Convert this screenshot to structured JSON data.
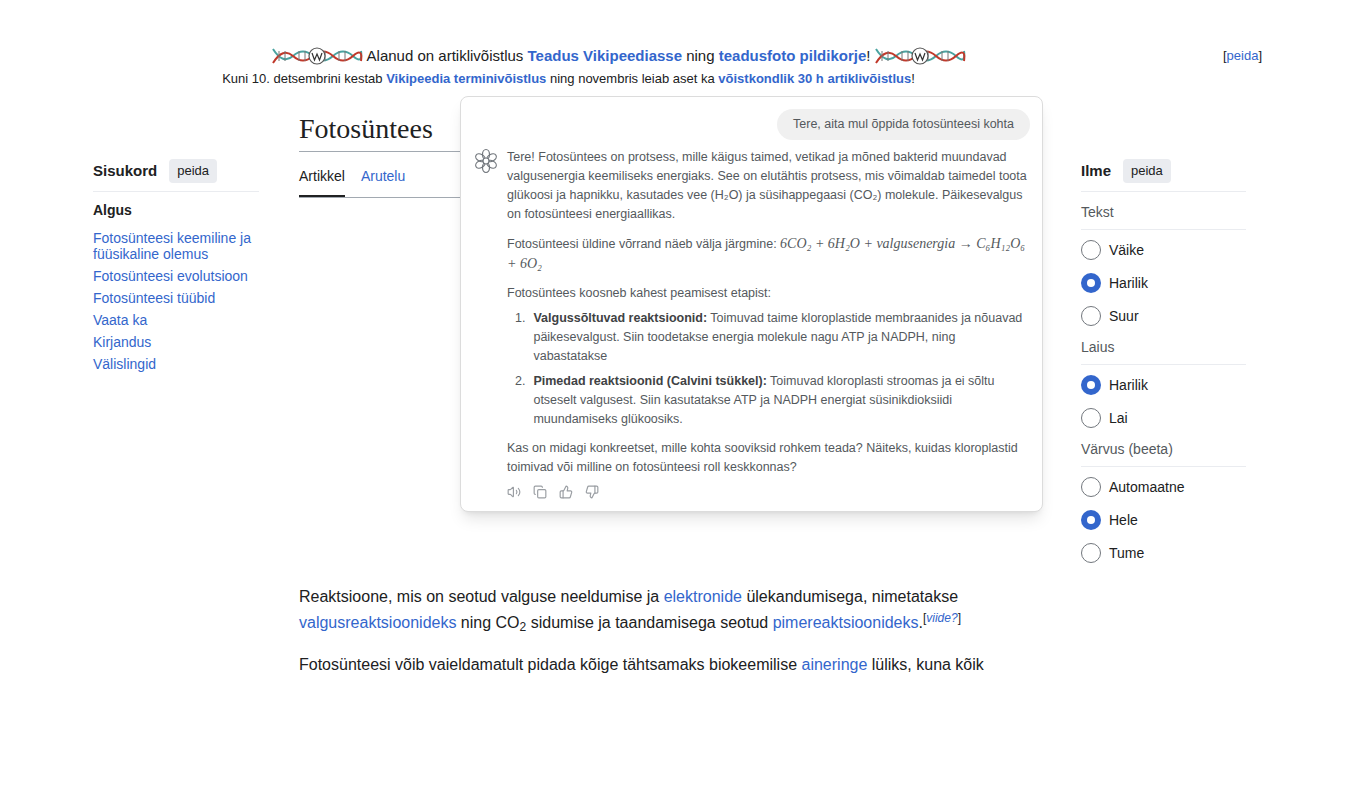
{
  "banner": {
    "line1": [
      {
        "kind": "text",
        "text": "Alanud on artiklivõistlus "
      },
      {
        "kind": "link",
        "text": "Teadus Vikipeediasse"
      },
      {
        "kind": "text",
        "text": " ning "
      },
      {
        "kind": "link",
        "text": "teadusfoto pildikorje"
      },
      {
        "kind": "text",
        "text": "!"
      }
    ],
    "line2": [
      {
        "kind": "text",
        "text": "Kuni 10. detsembrini kestab "
      },
      {
        "kind": "link",
        "text": "Vikipeedia terminivõistlus"
      },
      {
        "kind": "text",
        "text": " ning novembris leiab aset ka "
      },
      {
        "kind": "link",
        "text": "võistkondlik 30 h artiklivõistlus"
      },
      {
        "kind": "text",
        "text": "!"
      }
    ],
    "hide": {
      "open": "[",
      "text": "peida",
      "close": "]"
    }
  },
  "sidebar": {
    "title": "Sisukord",
    "hide": "peida",
    "items": [
      {
        "label": "Algus",
        "selected": true
      },
      {
        "label": "Fotosünteesi keemiline ja füüsikaline olemus",
        "selected": false
      },
      {
        "label": "Fotosünteesi evolutsioon",
        "selected": false
      },
      {
        "label": "Fotosünteesi tüübid",
        "selected": false
      },
      {
        "label": "Vaata ka",
        "selected": false
      },
      {
        "label": "Kirjandus",
        "selected": false
      },
      {
        "label": "Välislingid",
        "selected": false
      }
    ]
  },
  "article": {
    "title": "Fotosüntees",
    "tabs": [
      {
        "label": "Artikkel",
        "selected": true
      },
      {
        "label": "Arutelu",
        "selected": false
      }
    ],
    "paragraphs": [
      [
        {
          "kind": "text",
          "text": "Reaktsioone, mis on seotud valguse neeldumise ja "
        },
        {
          "kind": "link",
          "text": "elektronide"
        },
        {
          "kind": "text",
          "text": " ülekandumisega, nimetatakse "
        },
        {
          "kind": "link",
          "text": "valgusreaktsioonideks"
        },
        {
          "kind": "text",
          "text": " ning CO"
        },
        {
          "kind": "sub",
          "text": "2"
        },
        {
          "kind": "text",
          "text": " sidumise ja taandamisega seotud "
        },
        {
          "kind": "link",
          "text": "pimereaktsioonideks"
        },
        {
          "kind": "text",
          "text": "."
        },
        {
          "kind": "note",
          "open": "[",
          "text": "viide?",
          "close": "]"
        }
      ],
      [
        {
          "kind": "text",
          "text": "Fotosünteesi võib vaieldamatult pidada kõige tähtsamaks biokeemilise "
        },
        {
          "kind": "link",
          "text": "aineringe"
        },
        {
          "kind": "text",
          "text": " lüliks, kuna kõik"
        }
      ]
    ]
  },
  "chat": {
    "prompt": "Tere, aita mul õppida fotosünteesi kohta",
    "intro": "Tere! Fotosüntees on protsess, mille käigus taimed, vetikad ja mõned bakterid muundavad valgusenergia keemiliseks energiaks. See on elutähtis protsess, mis võimaldab taimedel toota glükoosi ja hapnikku, kasutades vee (H₂O) ja süsihappegaasi (CO₂) molekule. Päikesevalgus on fotosünteesi energiaallikas.",
    "equation_label": "Fotosünteesi üldine võrrand näeb välja järgmine:",
    "equation": "6CO₂ + 6H₂O + valgusenergia → C₆H₁₂O₆ + 6O₂",
    "stages_intro": "Fotosüntees koosneb kahest peamisest etapist:",
    "stages": [
      {
        "number": "1.",
        "title": "Valgussõltuvad reaktsioonid:",
        "text": "Toimuvad taime kloroplastide membraanides ja nõuavad päikesevalgust. Siin toodetakse energia molekule nagu ATP ja NADPH, ning vabastatakse"
      },
      {
        "number": "2.",
        "title": "Pimedad reaktsioonid (Calvini tsükkel):",
        "text": "Toimuvad kloroplasti stroomas ja ei sõltu otseselt valgusest. Siin kasutatakse ATP ja NADPH energiat süsinikdioksiidi muundamiseks glükoosiks."
      }
    ],
    "question": "Kas on midagi konkreetset, mille kohta sooviksid rohkem teada? Näiteks, kuidas kloroplastid toimivad või milline on fotosünteesi roll keskkonnas?"
  },
  "appearance": {
    "title": "Ilme",
    "hide": "peida",
    "groups": [
      {
        "label": "Tekst",
        "options": [
          {
            "label": "Väike",
            "selected": false
          },
          {
            "label": "Harilik",
            "selected": true
          },
          {
            "label": "Suur",
            "selected": false
          }
        ]
      },
      {
        "label": "Laius",
        "options": [
          {
            "label": "Harilik",
            "selected": true
          },
          {
            "label": "Lai",
            "selected": false
          }
        ]
      },
      {
        "label": "Värvus (beeta)",
        "options": [
          {
            "label": "Automaatne",
            "selected": false
          },
          {
            "label": "Hele",
            "selected": true
          },
          {
            "label": "Tume",
            "selected": false
          }
        ]
      }
    ]
  }
}
